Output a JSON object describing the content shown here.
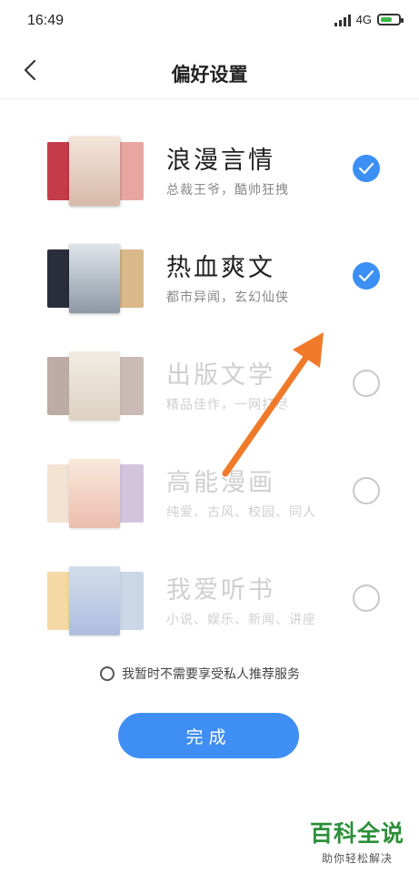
{
  "status_bar": {
    "time": "16:49",
    "network": "4G",
    "battery_color": "#3cb94a"
  },
  "header": {
    "title": "偏好设置"
  },
  "categories": [
    {
      "name": "浪漫言情",
      "desc": "总裁王爷，酷帅狂拽",
      "checked": true
    },
    {
      "name": "热血爽文",
      "desc": "都市异闻，玄幻仙侠",
      "checked": true
    },
    {
      "name": "出版文学",
      "desc": "精品佳作，一网打尽",
      "checked": false
    },
    {
      "name": "高能漫画",
      "desc": "纯爱、古风、校园、同人",
      "checked": false
    },
    {
      "name": "我爱听书",
      "desc": "小说、娱乐、新闻、讲座",
      "checked": false
    }
  ],
  "cover_art": {
    "c0": [
      "#c63b4a",
      "#f0d9c8",
      "#e8a6a0"
    ],
    "c1": [
      "#2a2e3a",
      "#bfc7cf",
      "#d9b88a"
    ],
    "c2": [
      "#6d4a3a",
      "#c9b48f",
      "#8b6a5e"
    ],
    "c3": [
      "#e6c2a0",
      "#d46f4f",
      "#9e7db8"
    ],
    "c4": [
      "#e7a93a",
      "#4c6fb8",
      "#88a7c9"
    ]
  },
  "optout": {
    "label": "我暂时不需要享受私人推荐服务"
  },
  "done_button": {
    "label": "完成"
  },
  "watermark": {
    "title": "百科全说",
    "subtitle": "助你轻松解决"
  },
  "colors": {
    "accent": "#3b8ff5",
    "arrow": "#f07a2a",
    "watermark_green": "#2d8f3a"
  }
}
